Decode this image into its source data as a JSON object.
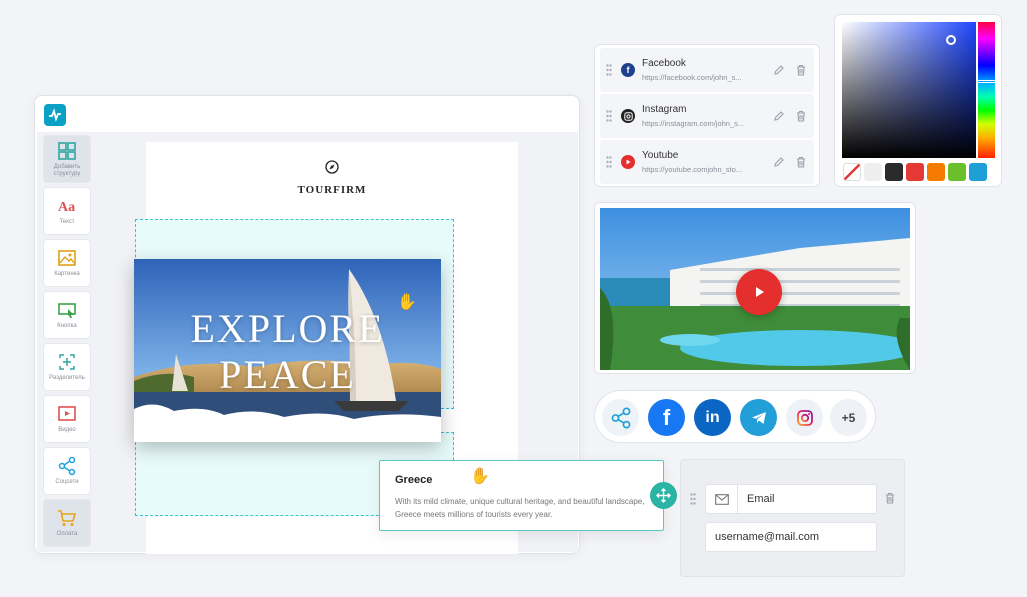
{
  "editor": {
    "tools": [
      {
        "label": "Добавить структуру",
        "icon": "grid-icon"
      },
      {
        "label": "Текст",
        "icon": "text-icon"
      },
      {
        "label": "Картинка",
        "icon": "image-icon"
      },
      {
        "label": "Кнопка",
        "icon": "button-icon"
      },
      {
        "label": "Разделитель",
        "icon": "divider-icon"
      },
      {
        "label": "Видео",
        "icon": "video-icon"
      },
      {
        "label": "Соцсети",
        "icon": "share-icon"
      },
      {
        "label": "Оплата",
        "icon": "cart-icon"
      }
    ],
    "brand": "TOURFIRM",
    "hero_line1": "EXPLORE",
    "hero_line2": "PEACE"
  },
  "greece": {
    "title": "Greece",
    "description": "With its mild climate, unique cultural heritage, and beautiful landscape, Greece meets millions of tourists every year."
  },
  "social_links": [
    {
      "name": "Facebook",
      "url": "https://facebook.com/john_s...",
      "color": "#1f3f8f"
    },
    {
      "name": "Instagram",
      "url": "https://instagram.com/john_s...",
      "color": "#222222"
    },
    {
      "name": "Youtube",
      "url": "https://youtube.comjohn_sto...",
      "color": "#e52e2e"
    }
  ],
  "color_picker": {
    "swatches": [
      "none",
      "#eeeeee",
      "#2b2b2b",
      "#e53935",
      "#f57c00",
      "#6bbf2a",
      "#1e9fd6"
    ]
  },
  "sharebar": {
    "more": "+5",
    "colors": {
      "facebook": "#1877f2",
      "linkedin": "#0a66c2",
      "telegram": "#229ed9"
    }
  },
  "email": {
    "label": "Email",
    "value": "username@mail.com"
  }
}
